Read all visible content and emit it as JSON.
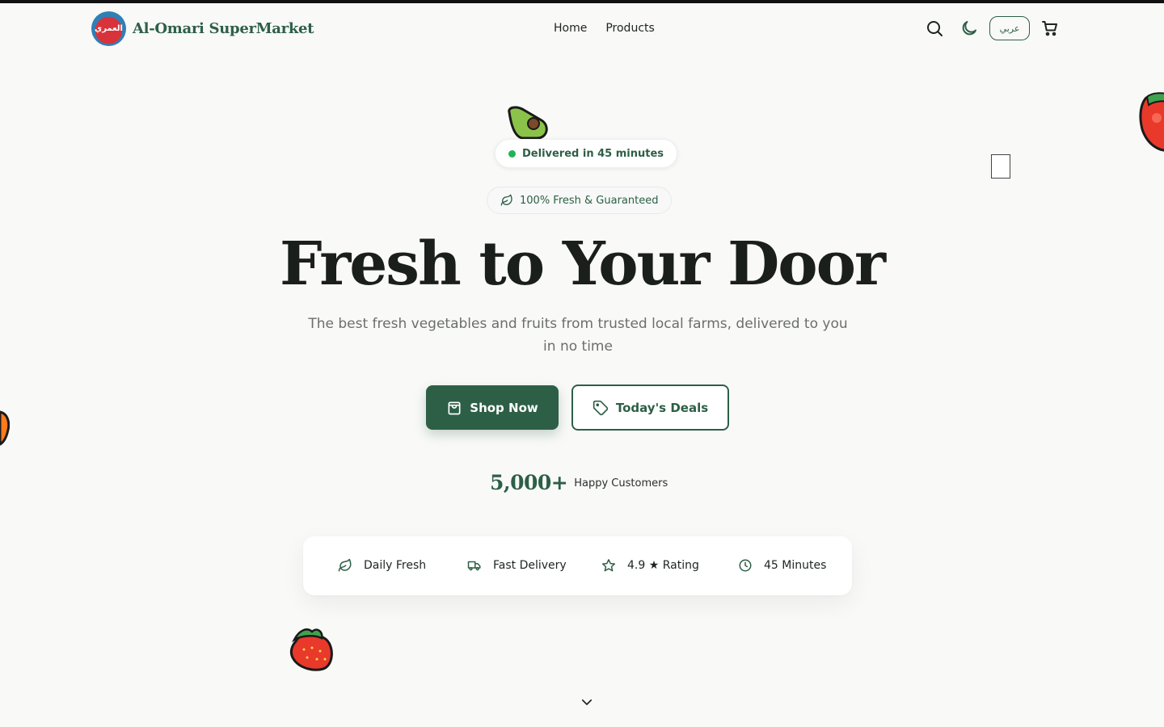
{
  "brand": {
    "name": "Al-Omari SuperMarket",
    "logo_text": "العمري"
  },
  "nav": {
    "home": "Home",
    "products": "Products"
  },
  "header": {
    "language_label": "عربي",
    "icons": [
      "search-icon",
      "moon-icon",
      "cart-icon"
    ]
  },
  "hero": {
    "delivery_badge": "Delivered in 45 minutes",
    "fresh_badge": "100% Fresh & Guaranteed",
    "title": "Fresh to Your Door",
    "subtitle": "The best fresh vegetables and fruits from trusted local farms, delivered to you in no time",
    "shop_button": "Shop Now",
    "deals_button": "Today's Deals"
  },
  "stats": {
    "number": "5,000+",
    "label": "Happy Customers"
  },
  "features": [
    {
      "icon": "leaf-icon",
      "label": "Daily Fresh"
    },
    {
      "icon": "truck-icon",
      "label": "Fast Delivery"
    },
    {
      "icon": "star-icon",
      "label": "4.9 ★ Rating"
    },
    {
      "icon": "clock-icon",
      "label": "45 Minutes"
    }
  ],
  "colors": {
    "brand_green": "#2d5f47",
    "status_green": "#22b35a",
    "background": "#f9f9f8"
  }
}
